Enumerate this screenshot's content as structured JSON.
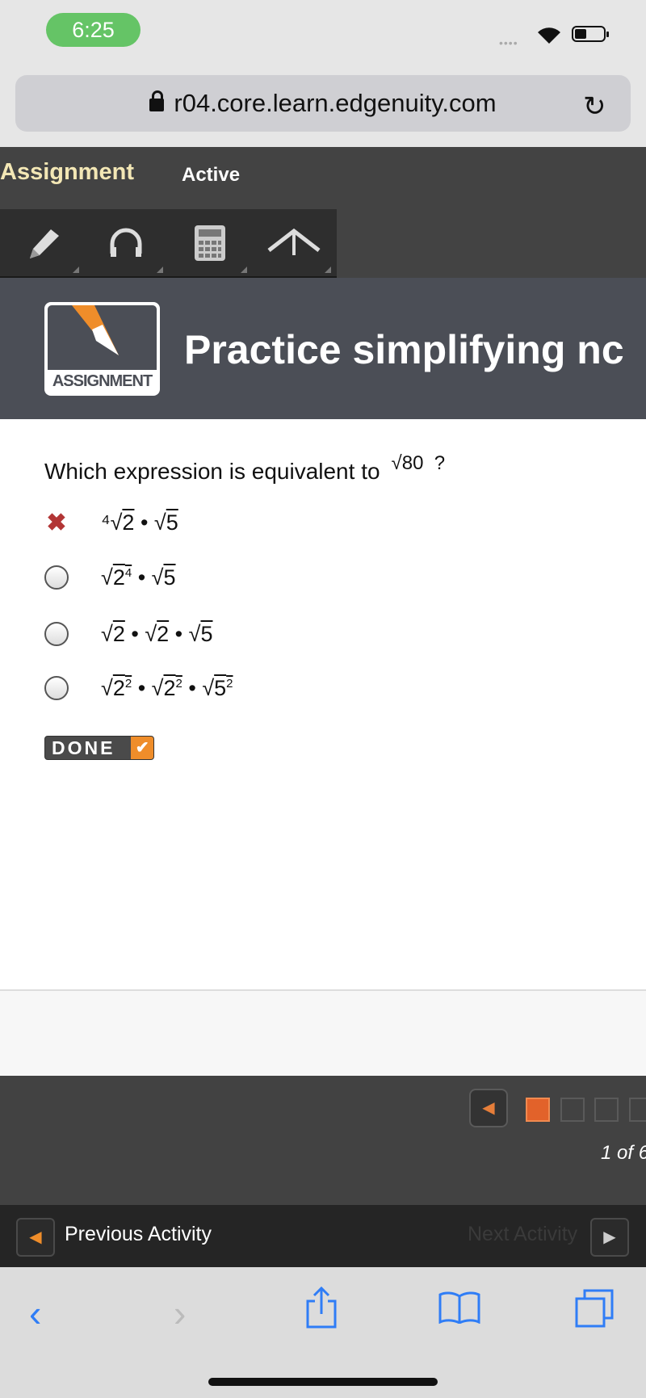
{
  "status_bar": {
    "time": "6:25",
    "signal": "••••",
    "wifi_icon": "wifi-icon",
    "battery_icon": "battery-icon"
  },
  "browser": {
    "url": "r04.core.learn.edgenuity.com",
    "reload_icon": "↻"
  },
  "nav": {
    "title": "Assignment",
    "status": "Active"
  },
  "toolbar": {
    "tools": [
      "pencil",
      "headphones",
      "calculator",
      "highlighter"
    ]
  },
  "header": {
    "logo_text": "ASSIGNMENT",
    "title": "Practice simplifying nc"
  },
  "question": {
    "text": "Which expression is equivalent to",
    "expression": "√80",
    "mark": "?"
  },
  "options": [
    {
      "state": "incorrect",
      "parts": [
        "⁴√",
        "2",
        " • √",
        "5"
      ]
    },
    {
      "state": "unselected",
      "parts": [
        "√",
        "2",
        "4",
        " • √",
        "5"
      ]
    },
    {
      "state": "unselected",
      "parts": [
        "√",
        "2",
        " • √",
        "2",
        " • √",
        "5"
      ]
    },
    {
      "state": "unselected",
      "parts": [
        "√",
        "2",
        "2",
        " • √",
        "2",
        "2",
        " • √",
        "5",
        "2"
      ]
    }
  ],
  "done_button": {
    "label": "DONE",
    "check": "✔"
  },
  "pager": {
    "count": "1 of 6",
    "current": 1,
    "colors": {
      "active": "#e2622a"
    }
  },
  "activity_nav": {
    "previous": "Previous Activity",
    "next": "Next Activity"
  },
  "colors": {
    "accent": "#ef8d2a",
    "incorrect": "#b23535",
    "safari_blue": "#2f7df6"
  }
}
